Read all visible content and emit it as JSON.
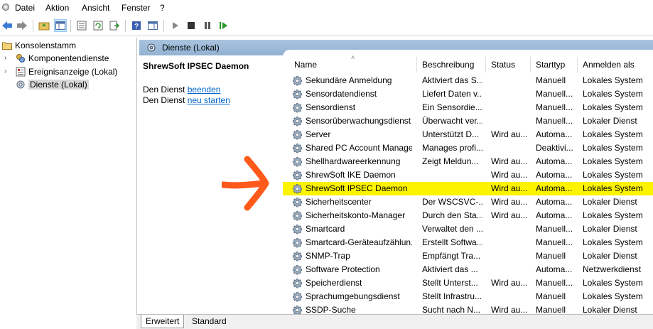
{
  "menu": [
    "Datei",
    "Aktion",
    "Ansicht",
    "Fenster",
    "?"
  ],
  "tree": {
    "root": "Konsolenstamm",
    "items": [
      "Komponentendienste",
      "Ereignisanzeige (Lokal)",
      "Dienste (Lokal)"
    ]
  },
  "pane": {
    "header": "Dienste (Lokal)",
    "selected_title": "ShrewSoft IPSEC Daemon",
    "line1_prefix": "Den Dienst ",
    "line1_link": "beenden",
    "line2_prefix": "Den Dienst ",
    "line2_link": "neu starten"
  },
  "columns": [
    "Name",
    "Beschreibung",
    "Status",
    "Starttyp",
    "Anmelden als"
  ],
  "rows": [
    [
      "Sekundäre Anmeldung",
      "Aktiviert das S...",
      "",
      "Manuell",
      "Lokales System"
    ],
    [
      "Sensordatendienst",
      "Liefert Daten v...",
      "",
      "Manuell...",
      "Lokales System"
    ],
    [
      "Sensordienst",
      "Ein Sensordie...",
      "",
      "Manuell...",
      "Lokales System"
    ],
    [
      "Sensorüberwachungsdienst",
      "Überwacht ver...",
      "",
      "Manuell...",
      "Lokaler Dienst"
    ],
    [
      "Server",
      "Unterstützt D...",
      "Wird au...",
      "Automa...",
      "Lokales System"
    ],
    [
      "Shared PC Account Manager",
      "Manages profi...",
      "",
      "Deaktivi...",
      "Lokales System"
    ],
    [
      "Shellhardwareerkennung",
      "Zeigt Meldun...",
      "Wird au...",
      "Automa...",
      "Lokales System"
    ],
    [
      "ShrewSoft IKE Daemon",
      "",
      "Wird au...",
      "Automa...",
      "Lokales System"
    ],
    [
      "ShrewSoft IPSEC Daemon",
      "",
      "Wird au...",
      "Automa...",
      "Lokales System"
    ],
    [
      "Sicherheitscenter",
      "Der WSCSVC-...",
      "Wird au...",
      "Automa...",
      "Lokaler Dienst"
    ],
    [
      "Sicherheitskonto-Manager",
      "Durch den Sta...",
      "Wird au...",
      "Automa...",
      "Lokales System"
    ],
    [
      "Smartcard",
      "Verwaltet den ...",
      "",
      "Manuell...",
      "Lokaler Dienst"
    ],
    [
      "Smartcard-Geräteaufzählun...",
      "Erstellt Softwa...",
      "",
      "Manuell...",
      "Lokales System"
    ],
    [
      "SNMP-Trap",
      "Empfängt Tra...",
      "",
      "Manuell",
      "Lokaler Dienst"
    ],
    [
      "Software Protection",
      "Aktiviert das ...",
      "",
      "Automa...",
      "Netzwerkdienst"
    ],
    [
      "Speicherdienst",
      "Stellt Unterst...",
      "Wird au...",
      "Manuell...",
      "Lokales System"
    ],
    [
      "Sprachumgebungsdienst",
      "Stellt Infrastru...",
      "",
      "Manuell",
      "Lokales System"
    ],
    [
      "SSDP-Suche",
      "Sucht nach N...",
      "Wird au...",
      "Manuell",
      "Lokaler Dienst"
    ]
  ],
  "highlighted_row_index": 8,
  "tabs": [
    "Erweitert",
    "Standard"
  ],
  "colors": {
    "highlight": "#fbf300",
    "arrow": "#ff5a1a",
    "header": "#a9c3de"
  }
}
